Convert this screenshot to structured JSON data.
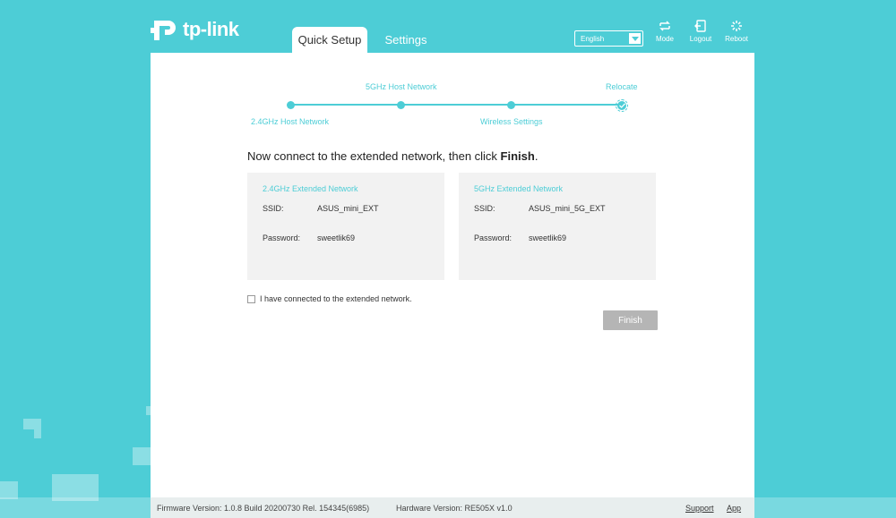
{
  "header": {
    "brand": "tp-link",
    "tabs": [
      {
        "label": "Quick Setup",
        "active": true
      },
      {
        "label": "Settings",
        "active": false
      }
    ],
    "language": "English",
    "icons": [
      {
        "name": "mode-icon",
        "label": "Mode"
      },
      {
        "name": "logout-icon",
        "label": "Logout"
      },
      {
        "name": "reboot-icon",
        "label": "Reboot"
      }
    ]
  },
  "progress": {
    "steps": [
      "2.4GHz Host Network",
      "5GHz Host Network",
      "Wireless Settings",
      "Relocate"
    ],
    "current_step": 4
  },
  "instruction": {
    "text": "Now connect to the extended network, then click ",
    "bold": "Finish",
    "suffix": "."
  },
  "networks": [
    {
      "title": "2.4GHz Extended Network",
      "ssid_label": "SSID:",
      "ssid": "ASUS_mini_EXT",
      "password_label": "Password:",
      "password": "sweetlik69"
    },
    {
      "title": "5GHz Extended Network",
      "ssid_label": "SSID:",
      "ssid": "ASUS_mini_5G_EXT",
      "password_label": "Password:",
      "password": "sweetlik69"
    }
  ],
  "confirm_checkbox": {
    "label": "I have connected to the extended network.",
    "checked": false
  },
  "finish_button": "Finish",
  "footer": {
    "firmware": "Firmware Version: 1.0.8 Build 20200730 Rel. 154345(6985)",
    "hardware": "Hardware Version: RE505X v1.0",
    "support": "Support",
    "app": "App"
  },
  "colors": {
    "accent": "#4dcdd6",
    "button_disabled": "#b5b5b5",
    "box_bg": "#f2f2f2"
  }
}
